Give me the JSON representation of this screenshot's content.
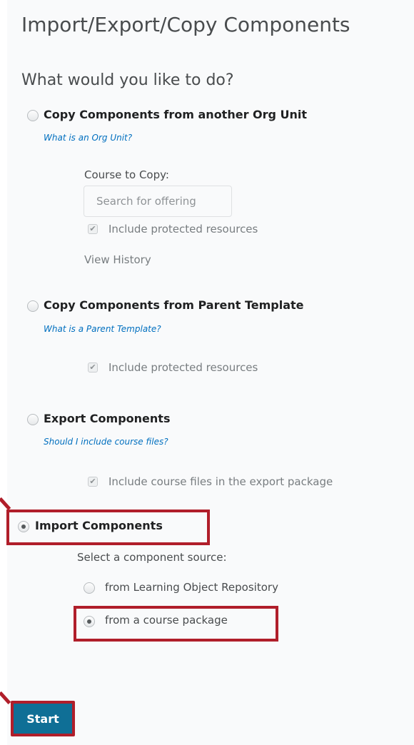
{
  "title": "Import/Export/Copy Components",
  "subtitle": "What would you like to do?",
  "options": {
    "copy_org": {
      "label": "Copy Components from another Org Unit",
      "help": "What is an Org Unit?",
      "course_label": "Course to Copy:",
      "search_placeholder": "Search for offering",
      "checkbox_label": "Include protected resources",
      "view_history": "View History"
    },
    "copy_parent": {
      "label": "Copy Components from Parent Template",
      "help": "What is a Parent Template?",
      "checkbox_label": "Include protected resources"
    },
    "export": {
      "label": "Export Components",
      "help": "Should I include course files?",
      "checkbox_label": "Include course files in the export package"
    },
    "import": {
      "label": "Import Components",
      "source_label": "Select a component source:",
      "source_lor": "from Learning Object Repository",
      "source_package": "from a course package"
    }
  },
  "start_label": "Start",
  "colors": {
    "highlight": "#b01e2a",
    "primary_button": "#0f6f96",
    "link": "#006fbf"
  }
}
